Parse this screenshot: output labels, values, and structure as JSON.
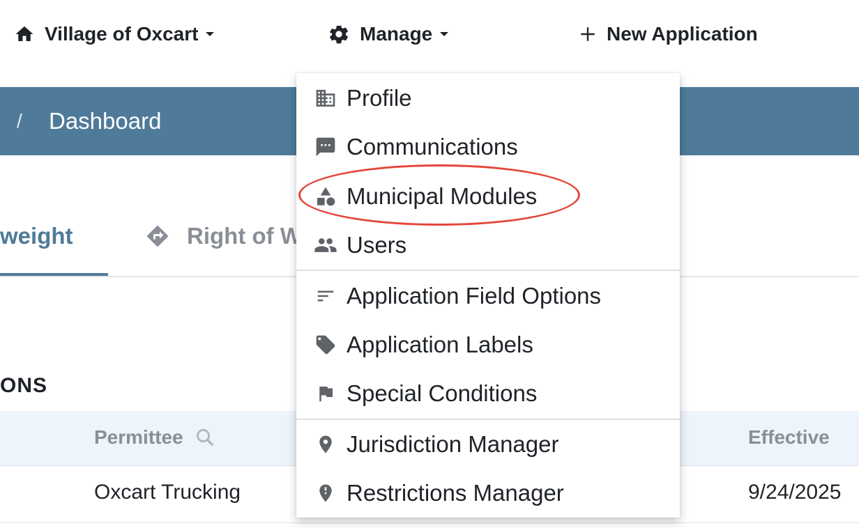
{
  "nav": {
    "org": "Village of Oxcart",
    "manage": "Manage",
    "new_application": "New Application"
  },
  "breadcrumb": {
    "separator": "/",
    "current": "Dashboard"
  },
  "tabs": {
    "active": "weight",
    "second": "Right of W"
  },
  "section": {
    "heading": "ONS"
  },
  "table": {
    "headers": [
      "Permittee",
      "Effective"
    ],
    "rows": [
      {
        "permittee": "Oxcart Trucking",
        "effective": "9/24/2025"
      }
    ]
  },
  "manage_menu": {
    "items": [
      {
        "label": "Profile",
        "icon": "building-icon"
      },
      {
        "label": "Communications",
        "icon": "message-icon"
      },
      {
        "label": "Municipal Modules",
        "icon": "shapes-icon"
      },
      {
        "label": "Users",
        "icon": "users-icon"
      },
      {
        "label": "Application Field Options",
        "icon": "sort-lines-icon"
      },
      {
        "label": "Application Labels",
        "icon": "tag-icon"
      },
      {
        "label": "Special Conditions",
        "icon": "flag-icon"
      },
      {
        "label": "Jurisdiction Manager",
        "icon": "map-pin-icon"
      },
      {
        "label": "Restrictions Manager",
        "icon": "alert-pin-icon"
      }
    ]
  },
  "colors": {
    "brand": "#4f7a9a",
    "highlight": "#e4463a",
    "muted": "#8a8f96"
  }
}
